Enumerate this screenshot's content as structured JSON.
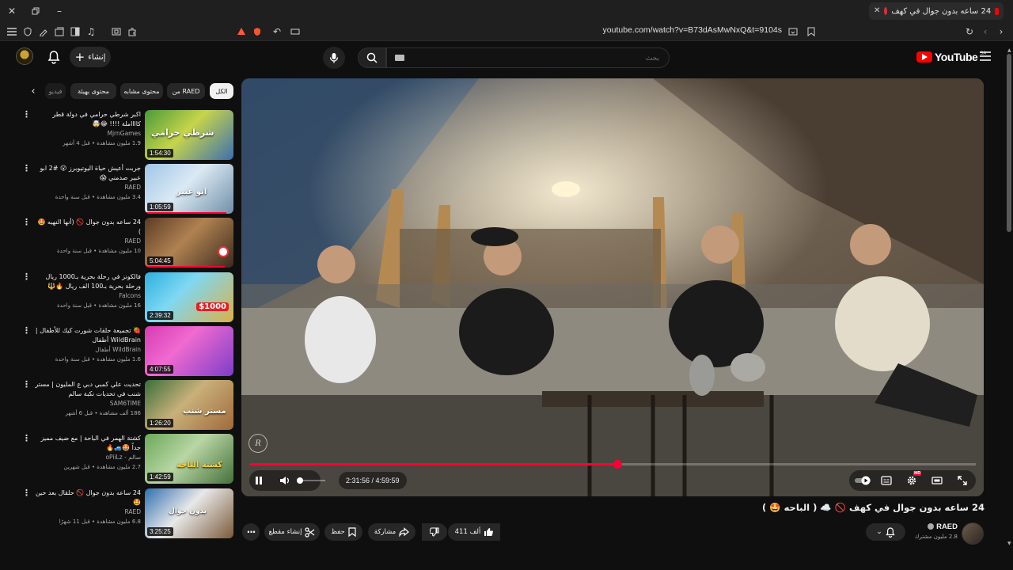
{
  "browser": {
    "tab_title": "24 ساعه بدون جوال في كهف",
    "url": "youtube.com/watch?v=B73dAsMwNxQ&t=9104s"
  },
  "header": {
    "logo_text": "YouTube",
    "country_code": "SA",
    "search_placeholder": "بحث",
    "create_label": "إنشاء"
  },
  "chips": [
    {
      "label": "الكل",
      "active": true
    },
    {
      "label": "من RAED",
      "active": false
    },
    {
      "label": "محتوى مشابه",
      "active": false
    },
    {
      "label": "محتوى بهيئة",
      "active": false
    },
    {
      "label": "فيديو",
      "active": false
    }
  ],
  "recommendations": [
    {
      "title": "اكبر شرطي حرامي في دولة قطر كااااملة !!!! 😂🤯",
      "channel": "MjrnGames",
      "meta": "1.9 مليون مشاهدة • قبل 4 أشهر",
      "duration": "1:54:30",
      "thumb_text": "شرطي حرامي",
      "progress": 0
    },
    {
      "title": "جربت أعيش حياة اليوتيوبرز 😮 #2 ابو عبير صدمني 😱",
      "channel": "RAED",
      "meta": "3.4 مليون مشاهدة • قبل سنة واحدة",
      "duration": "1:05:59",
      "thumb_text": "ابو عبير",
      "progress": 0.92
    },
    {
      "title": "24 ساعه بدون جوال 🚫 (أنها النهيه 🤩 )",
      "channel": "RAED",
      "meta": "10 مليون مشاهدة • قبل سنة واحدة",
      "duration": "5:04:45",
      "thumb_text": "",
      "progress": 0.9
    },
    {
      "title": "فالكونز في رحلة بحرية بـ1000 ريال ورحلة بحرية بـ100 الف ريال 🔥🔱",
      "channel": "Falcons",
      "meta": "16 مليون مشاهدة • قبل سنة واحدة",
      "duration": "2:39:32",
      "thumb_text": "$1000",
      "progress": 0
    },
    {
      "title": "🍓 تجميعة حلقات شورت كيك للأطفال | WildBrain أطفال",
      "channel": "WildBrain أطفال",
      "meta": "1.6 مليون مشاهدة • قبل سنة واحدة",
      "duration": "4:07:55",
      "thumb_text": "",
      "progress": 0
    },
    {
      "title": "تحديت علي كمبي دبي ع المليون | مستر شنب في تحديات نكبة سالم",
      "channel": "SAM6TIME",
      "meta": "186 ألف مشاهدة • قبل 6 أشهر",
      "duration": "1:26:20",
      "thumb_text": "مستر شنب",
      "progress": 0
    },
    {
      "title": "كشتة الهمر في الباحة | مع ضيف مميز جداً 🤩🚙🔥",
      "channel": "سالم - oPiiLz",
      "meta": "2.7 مليون مشاهدة • قبل شهرين",
      "duration": "1:42:59",
      "thumb_text": "كشتة الباحة",
      "progress": 0
    },
    {
      "title": "24 ساعه بدون جوال 🚫 حلقال بعد حين 🤩",
      "channel": "RAED",
      "meta": "6.8 مليون مشاهدة • قبل 11 شهرًا",
      "duration": "3:25:25",
      "thumb_text": "بدون جوال",
      "progress": 0
    }
  ],
  "player": {
    "current_time": "2:31:56",
    "total_time": "4:59:59",
    "time_display": "2:31:56 / 4:59:59",
    "progress_fraction": 0.506,
    "volume_fraction": 0.1,
    "quality_badge": "HD"
  },
  "video": {
    "title": "24 ساعه بدون جوال في كهف 🚫 ☁️ ( الباحه 🤩 )",
    "channel_name": "RAED",
    "subscribers": "2.8 مليون مشترك",
    "like_count": "411 ألف",
    "share_label": "مشاركة",
    "save_label": "حفظ",
    "clip_label": "إنشاء مقطع"
  },
  "colors": {
    "accent_red": "#ff0033",
    "background": "#0f0f0f",
    "chip_bg": "#272727"
  }
}
